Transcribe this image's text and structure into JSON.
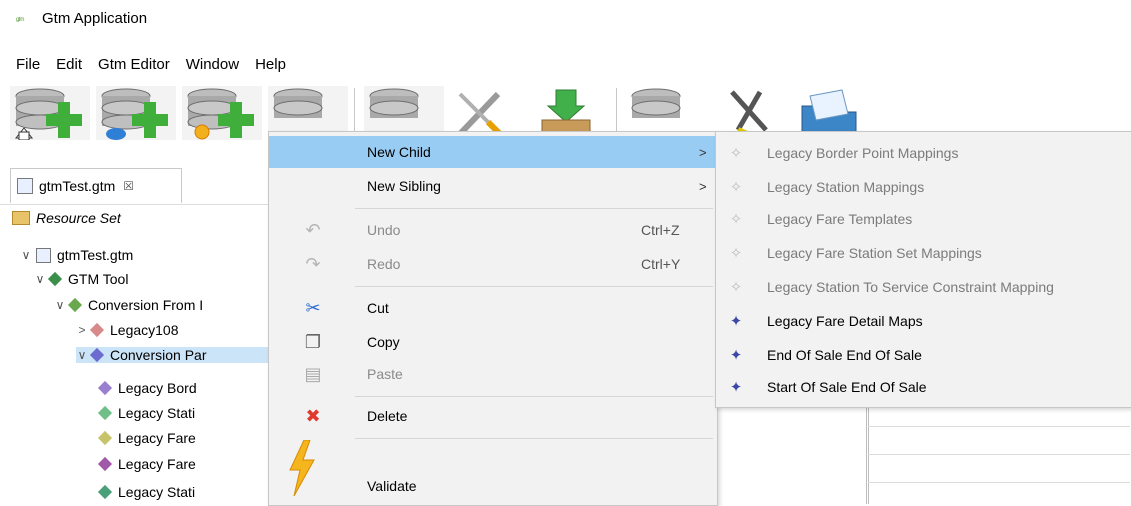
{
  "window": {
    "app_icon_text": "ᵍᵗᵐ",
    "title": "Gtm Application"
  },
  "menubar": [
    "File",
    "Edit",
    "Gtm Editor",
    "Window",
    "Help"
  ],
  "editor_tab": {
    "label": "gtmTest.gtm",
    "close_glyph": "☒"
  },
  "tree": {
    "resource_set": "Resource Set",
    "rows": [
      {
        "label": "gtmTest.gtm",
        "twisty": "∨",
        "color": "#7aa6d8"
      },
      {
        "label": "GTM Tool",
        "twisty": "∨",
        "color": "#3a8f4a"
      },
      {
        "label": "Conversion From I",
        "twisty": "∨",
        "color": "#6aa84f"
      },
      {
        "label": "Legacy108",
        "twisty": ">",
        "color": "#d88a8a"
      },
      {
        "label": "Conversion Par",
        "twisty": "∨",
        "color": "#6b6bd0"
      },
      {
        "label": "Legacy Bord",
        "twisty": "",
        "color": "#9a7fd0"
      },
      {
        "label": "Legacy Stati",
        "twisty": "",
        "color": "#6fbf86"
      },
      {
        "label": "Legacy Fare",
        "twisty": "",
        "color": "#c7c36a"
      },
      {
        "label": "Legacy Fare",
        "twisty": "",
        "color": "#a05aa8"
      },
      {
        "label": "Legacy Stati",
        "twisty": "",
        "color": "#4aa07a"
      }
    ]
  },
  "context_menu": {
    "new_child": "New Child",
    "new_sibling": "New Sibling",
    "undo": "Undo",
    "undo_shortcut": "Ctrl+Z",
    "redo": "Redo",
    "redo_shortcut": "Ctrl+Y",
    "cut": "Cut",
    "copy": "Copy",
    "paste": "Paste",
    "delete": "Delete",
    "validate": "Validate",
    "arrow_glyph": ">"
  },
  "submenu": {
    "items": [
      {
        "label": "Legacy Border Point Mappings",
        "enabled": false
      },
      {
        "label": "Legacy Station Mappings",
        "enabled": false
      },
      {
        "label": "Legacy Fare Templates",
        "enabled": false
      },
      {
        "label": "Legacy Fare Station Set Mappings",
        "enabled": false
      },
      {
        "label": "Legacy Station To Service Constraint Mapping",
        "enabled": false
      },
      {
        "label": "Legacy Fare Detail Maps",
        "enabled": true
      },
      {
        "label": "End Of Sale End Of Sale",
        "enabled": true
      },
      {
        "label": "Start Of Sale End Of Sale",
        "enabled": true
      }
    ]
  },
  "colors": {
    "menu_hover": "#99ccf3",
    "tree_selection": "#cce4f7",
    "add_green": "#3fae3a"
  }
}
